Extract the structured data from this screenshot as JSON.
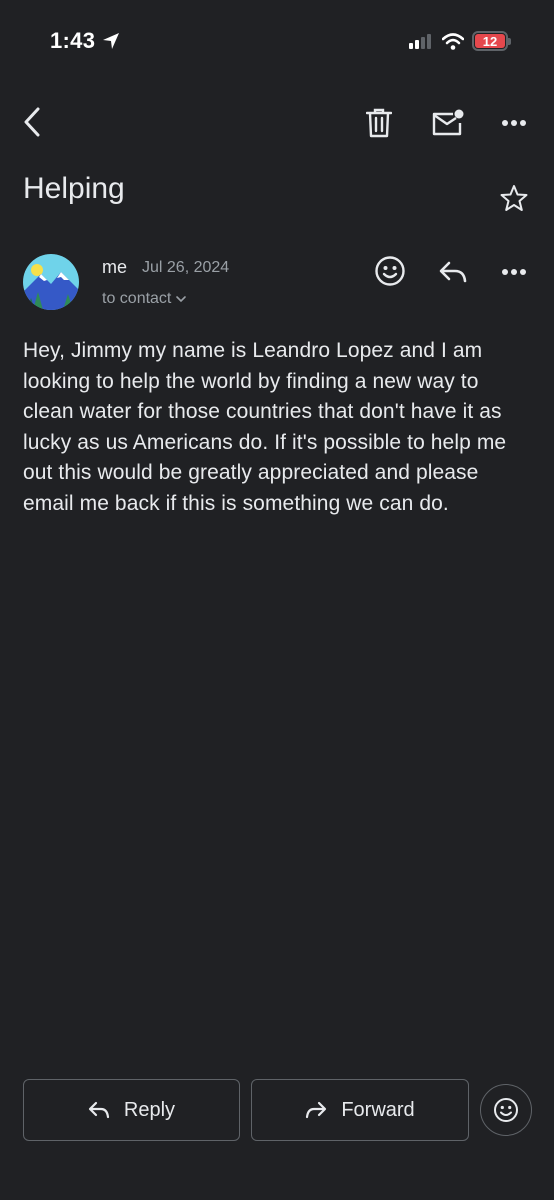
{
  "status_bar": {
    "time": "1:43",
    "battery_level": "12",
    "icons": [
      "location-arrow-icon",
      "signal-icon",
      "wifi-icon",
      "battery-icon"
    ]
  },
  "toolbar": {
    "icons": [
      "back-icon",
      "delete-icon",
      "mark-unread-icon",
      "more-icon"
    ]
  },
  "email": {
    "subject": "Helping",
    "sender": "me",
    "date": "Jul 26, 2024",
    "to_label": "to contact",
    "body": "Hey, Jimmy my name is Leandro Lopez and I am looking to help the world by finding a new way to clean water for those countries that don't have it as lucky as us Americans do. If it's possible to help me out this would be greatly appreciated and please email me back if this is something we can do."
  },
  "actions": {
    "reply_label": "Reply",
    "forward_label": "Forward"
  },
  "colors": {
    "background": "#202124",
    "text": "#e8eaed",
    "muted": "#9aa0a6",
    "battery": "#e5484d"
  }
}
